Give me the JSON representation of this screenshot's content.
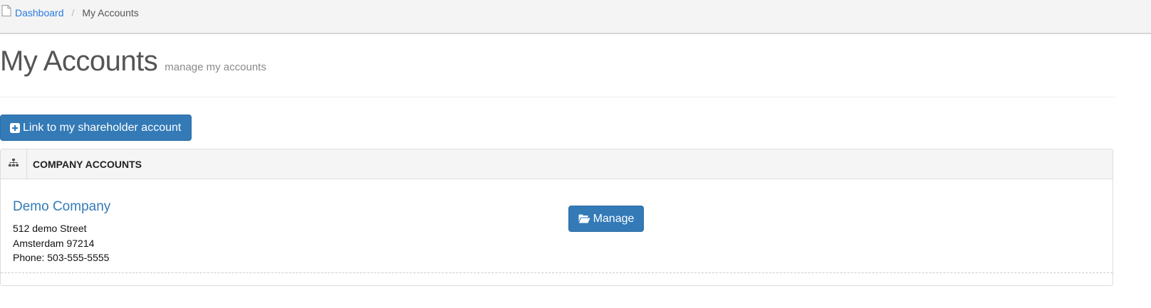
{
  "breadcrumb": {
    "home_label": "Dashboard",
    "separator": "/",
    "current_label": "My Accounts"
  },
  "header": {
    "title": "My Accounts",
    "subtitle": "manage my accounts"
  },
  "actions": {
    "link_account_label": "Link to my shareholder account"
  },
  "panel": {
    "title": "COMPANY ACCOUNTS",
    "companies": [
      {
        "name": "Demo Company",
        "address_line1": "512 demo Street",
        "address_line2": "Amsterdam 97214",
        "phone": "Phone: 503-555-5555",
        "manage_label": "Manage"
      }
    ]
  },
  "icons": {
    "breadcrumb": "document-icon",
    "link_button": "plus-square-icon",
    "panel": "sitemap-icon",
    "manage_button": "folder-open-icon"
  },
  "colors": {
    "primary": "#337ab7",
    "link": "#2a7ae2",
    "breadcrumb_bg": "#f4f4f4"
  }
}
